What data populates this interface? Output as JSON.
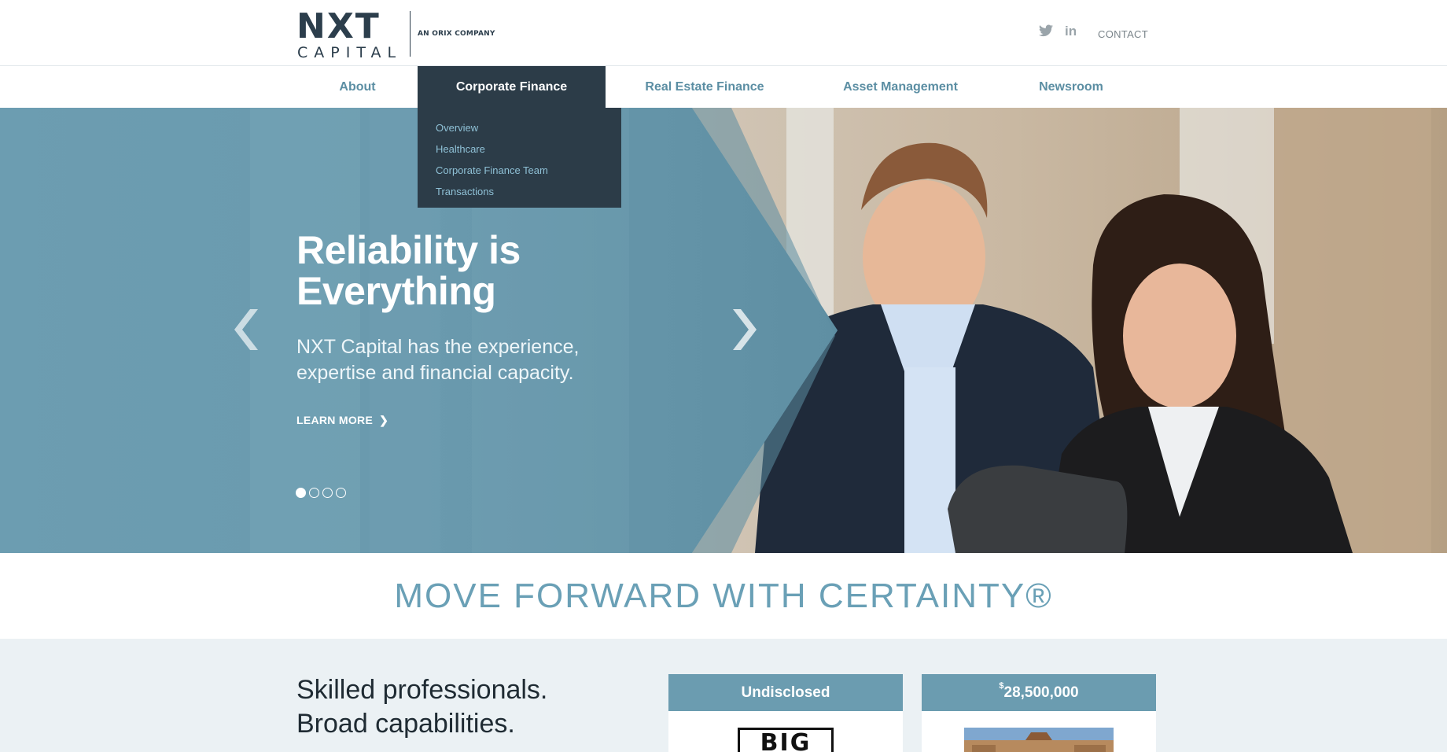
{
  "header": {
    "logo_primary": "NXT",
    "logo_secondary": "CAPITAL",
    "logo_tagline": "AN ORIX COMPANY",
    "social": [
      {
        "icon": "twitter-icon"
      },
      {
        "icon": "linkedin-icon",
        "glyph": "in"
      }
    ],
    "contact_label": "CONTACT"
  },
  "nav": {
    "items": [
      {
        "label": "About"
      },
      {
        "label": "Corporate Finance"
      },
      {
        "label": "Real Estate Finance"
      },
      {
        "label": "Asset Management"
      },
      {
        "label": "Newsroom"
      }
    ],
    "active": "Corporate Finance"
  },
  "dropdown": {
    "items": [
      {
        "label": "Overview"
      },
      {
        "label": "Healthcare"
      },
      {
        "label": "Corporate Finance Team"
      },
      {
        "label": "Transactions"
      }
    ]
  },
  "hero": {
    "title": "Reliability is Everything",
    "subtitle": "NXT Capital has the experience, expertise and financial capacity.",
    "cta_label": "LEARN MORE",
    "cta_icon": "chevron-right-icon",
    "prev_icon": "chevron-left-icon",
    "next_icon": "chevron-right-icon",
    "slide_count": 4,
    "current_slide": 1,
    "accent_color": "#6b9cb0"
  },
  "tagline": {
    "text": "MOVE FORWARD WITH CERTAINTY®"
  },
  "lower": {
    "lines": [
      "Skilled professionals.",
      "Broad capabilities."
    ],
    "cards": [
      {
        "heading": "Undisclosed",
        "image_text": "BIG"
      },
      {
        "heading_prefix": "$",
        "heading": "28,500,000"
      }
    ]
  },
  "colors": {
    "nav_text": "#5b8ea3",
    "nav_active_bg": "#2c3c48",
    "dropdown_text": "#8fc1d6",
    "tagline": "#6aa0b6",
    "lower_bg": "#ebf1f4"
  }
}
